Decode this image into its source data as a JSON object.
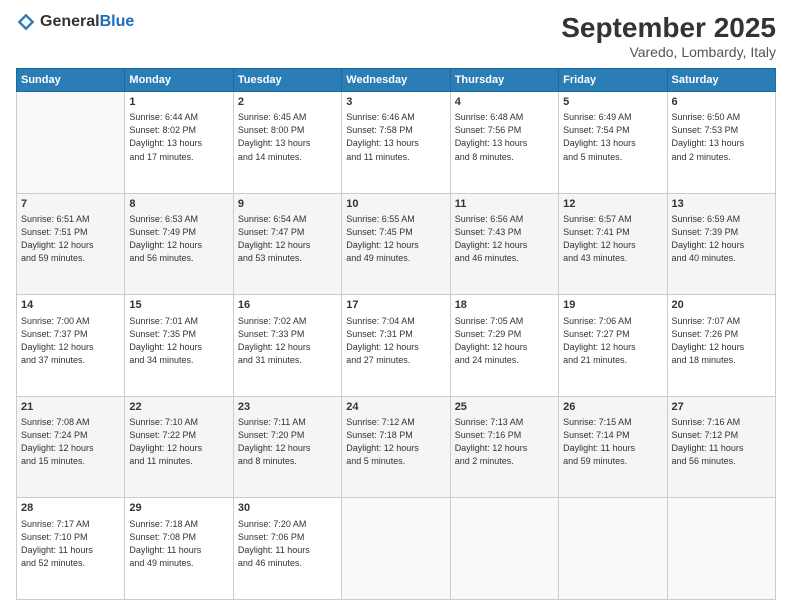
{
  "logo": {
    "general": "General",
    "blue": "Blue"
  },
  "header": {
    "month": "September 2025",
    "location": "Varedo, Lombardy, Italy"
  },
  "weekdays": [
    "Sunday",
    "Monday",
    "Tuesday",
    "Wednesday",
    "Thursday",
    "Friday",
    "Saturday"
  ],
  "weeks": [
    [
      {
        "num": "",
        "info": ""
      },
      {
        "num": "1",
        "info": "Sunrise: 6:44 AM\nSunset: 8:02 PM\nDaylight: 13 hours\nand 17 minutes."
      },
      {
        "num": "2",
        "info": "Sunrise: 6:45 AM\nSunset: 8:00 PM\nDaylight: 13 hours\nand 14 minutes."
      },
      {
        "num": "3",
        "info": "Sunrise: 6:46 AM\nSunset: 7:58 PM\nDaylight: 13 hours\nand 11 minutes."
      },
      {
        "num": "4",
        "info": "Sunrise: 6:48 AM\nSunset: 7:56 PM\nDaylight: 13 hours\nand 8 minutes."
      },
      {
        "num": "5",
        "info": "Sunrise: 6:49 AM\nSunset: 7:54 PM\nDaylight: 13 hours\nand 5 minutes."
      },
      {
        "num": "6",
        "info": "Sunrise: 6:50 AM\nSunset: 7:53 PM\nDaylight: 13 hours\nand 2 minutes."
      }
    ],
    [
      {
        "num": "7",
        "info": "Sunrise: 6:51 AM\nSunset: 7:51 PM\nDaylight: 12 hours\nand 59 minutes."
      },
      {
        "num": "8",
        "info": "Sunrise: 6:53 AM\nSunset: 7:49 PM\nDaylight: 12 hours\nand 56 minutes."
      },
      {
        "num": "9",
        "info": "Sunrise: 6:54 AM\nSunset: 7:47 PM\nDaylight: 12 hours\nand 53 minutes."
      },
      {
        "num": "10",
        "info": "Sunrise: 6:55 AM\nSunset: 7:45 PM\nDaylight: 12 hours\nand 49 minutes."
      },
      {
        "num": "11",
        "info": "Sunrise: 6:56 AM\nSunset: 7:43 PM\nDaylight: 12 hours\nand 46 minutes."
      },
      {
        "num": "12",
        "info": "Sunrise: 6:57 AM\nSunset: 7:41 PM\nDaylight: 12 hours\nand 43 minutes."
      },
      {
        "num": "13",
        "info": "Sunrise: 6:59 AM\nSunset: 7:39 PM\nDaylight: 12 hours\nand 40 minutes."
      }
    ],
    [
      {
        "num": "14",
        "info": "Sunrise: 7:00 AM\nSunset: 7:37 PM\nDaylight: 12 hours\nand 37 minutes."
      },
      {
        "num": "15",
        "info": "Sunrise: 7:01 AM\nSunset: 7:35 PM\nDaylight: 12 hours\nand 34 minutes."
      },
      {
        "num": "16",
        "info": "Sunrise: 7:02 AM\nSunset: 7:33 PM\nDaylight: 12 hours\nand 31 minutes."
      },
      {
        "num": "17",
        "info": "Sunrise: 7:04 AM\nSunset: 7:31 PM\nDaylight: 12 hours\nand 27 minutes."
      },
      {
        "num": "18",
        "info": "Sunrise: 7:05 AM\nSunset: 7:29 PM\nDaylight: 12 hours\nand 24 minutes."
      },
      {
        "num": "19",
        "info": "Sunrise: 7:06 AM\nSunset: 7:27 PM\nDaylight: 12 hours\nand 21 minutes."
      },
      {
        "num": "20",
        "info": "Sunrise: 7:07 AM\nSunset: 7:26 PM\nDaylight: 12 hours\nand 18 minutes."
      }
    ],
    [
      {
        "num": "21",
        "info": "Sunrise: 7:08 AM\nSunset: 7:24 PM\nDaylight: 12 hours\nand 15 minutes."
      },
      {
        "num": "22",
        "info": "Sunrise: 7:10 AM\nSunset: 7:22 PM\nDaylight: 12 hours\nand 11 minutes."
      },
      {
        "num": "23",
        "info": "Sunrise: 7:11 AM\nSunset: 7:20 PM\nDaylight: 12 hours\nand 8 minutes."
      },
      {
        "num": "24",
        "info": "Sunrise: 7:12 AM\nSunset: 7:18 PM\nDaylight: 12 hours\nand 5 minutes."
      },
      {
        "num": "25",
        "info": "Sunrise: 7:13 AM\nSunset: 7:16 PM\nDaylight: 12 hours\nand 2 minutes."
      },
      {
        "num": "26",
        "info": "Sunrise: 7:15 AM\nSunset: 7:14 PM\nDaylight: 11 hours\nand 59 minutes."
      },
      {
        "num": "27",
        "info": "Sunrise: 7:16 AM\nSunset: 7:12 PM\nDaylight: 11 hours\nand 56 minutes."
      }
    ],
    [
      {
        "num": "28",
        "info": "Sunrise: 7:17 AM\nSunset: 7:10 PM\nDaylight: 11 hours\nand 52 minutes."
      },
      {
        "num": "29",
        "info": "Sunrise: 7:18 AM\nSunset: 7:08 PM\nDaylight: 11 hours\nand 49 minutes."
      },
      {
        "num": "30",
        "info": "Sunrise: 7:20 AM\nSunset: 7:06 PM\nDaylight: 11 hours\nand 46 minutes."
      },
      {
        "num": "",
        "info": ""
      },
      {
        "num": "",
        "info": ""
      },
      {
        "num": "",
        "info": ""
      },
      {
        "num": "",
        "info": ""
      }
    ]
  ]
}
